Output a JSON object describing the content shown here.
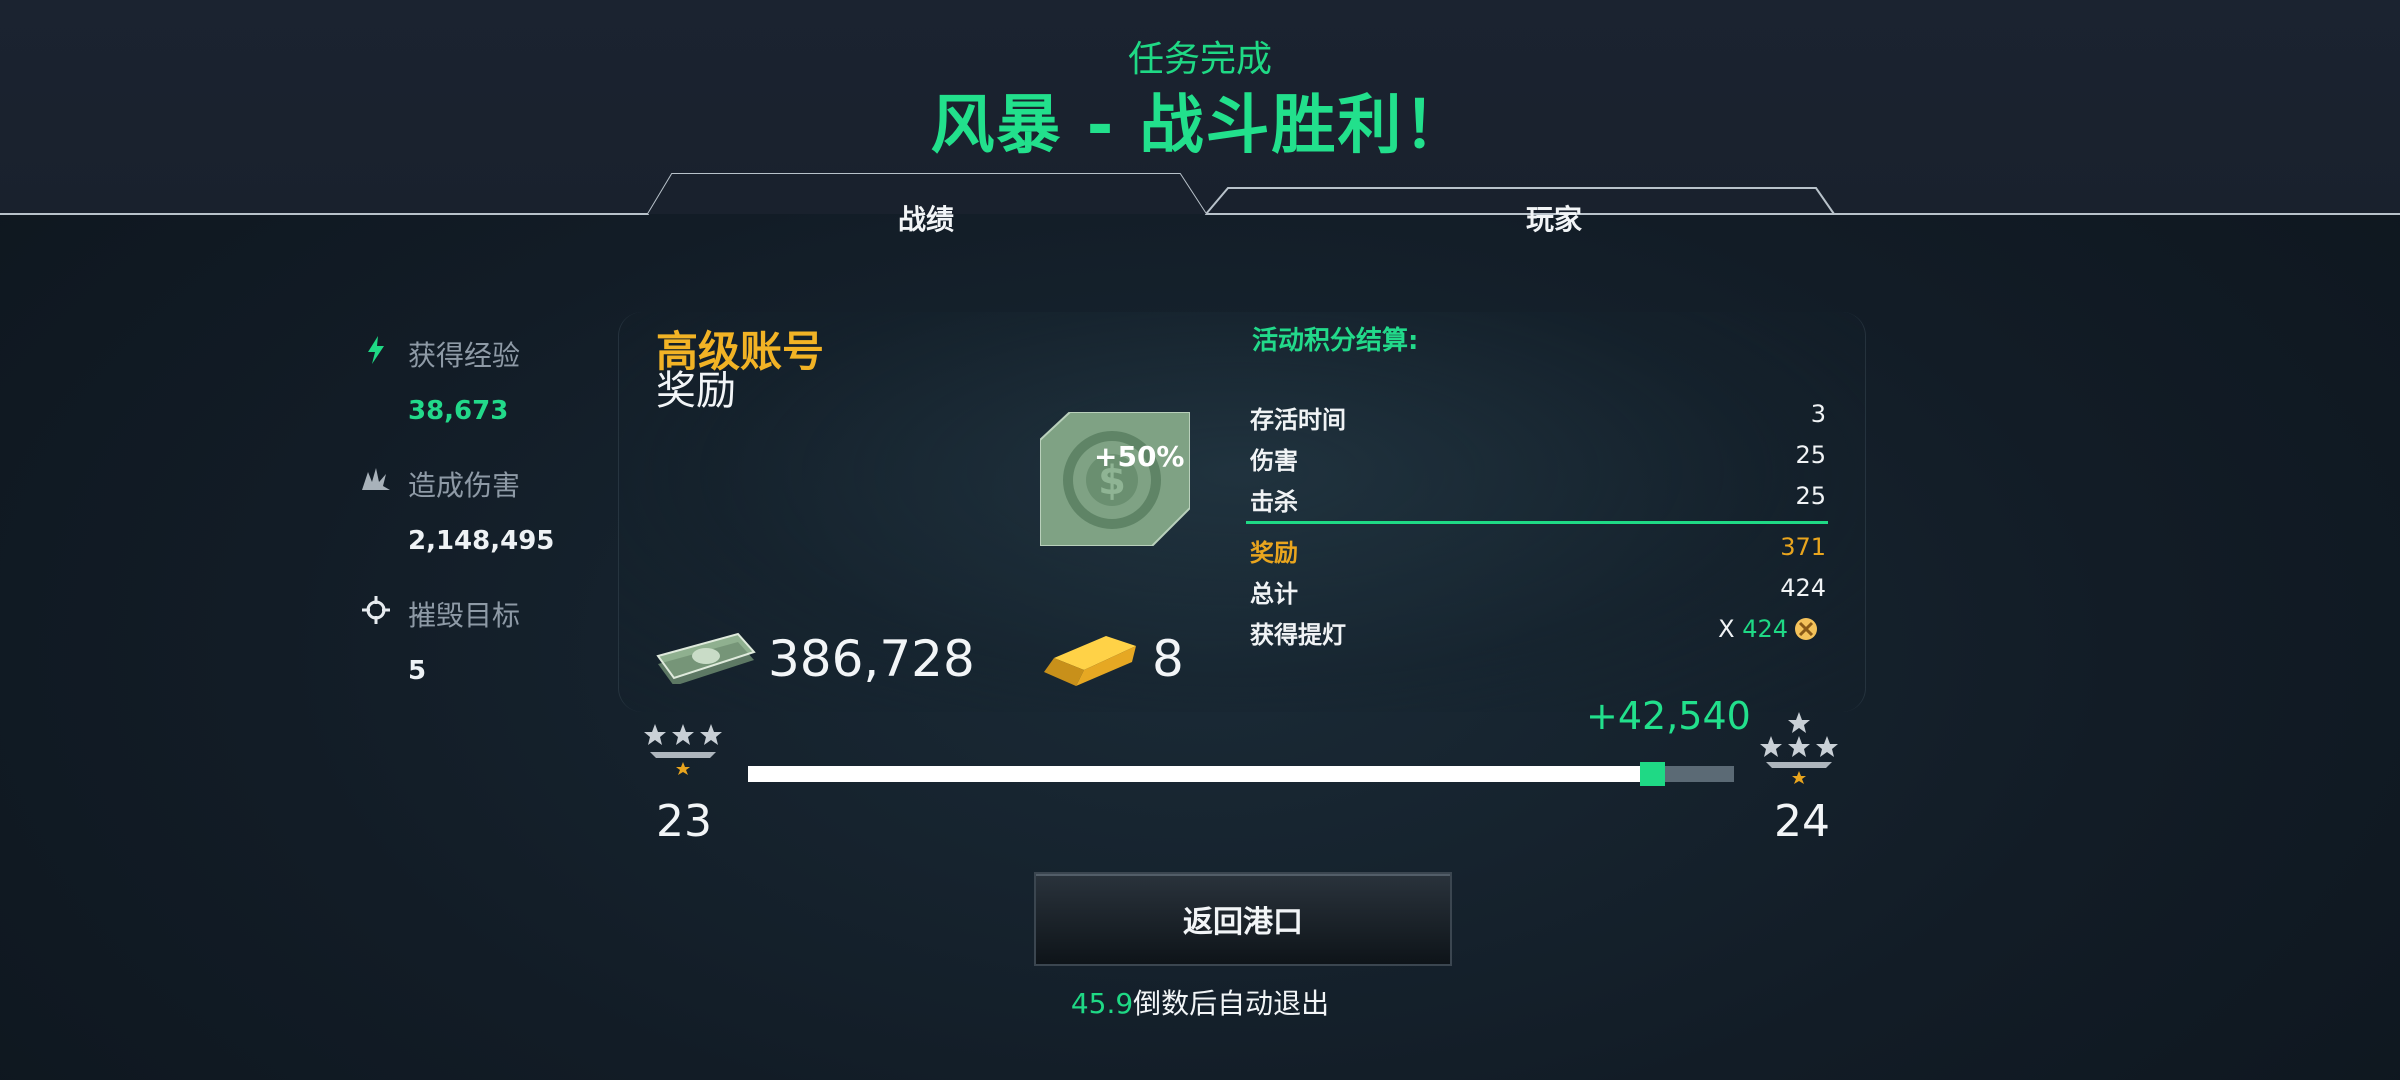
{
  "header": {
    "subtitle": "任务完成",
    "title": "风暴 - 战斗胜利！"
  },
  "tabs": [
    {
      "label": "战绩",
      "active": true
    },
    {
      "label": "玩家",
      "active": false
    }
  ],
  "stats": [
    {
      "icon": "lightning-icon",
      "label": "获得经验",
      "value": "38,673",
      "value_color": "#22d98a"
    },
    {
      "icon": "explosion-icon",
      "label": "造成伤害",
      "value": "2,148,495"
    },
    {
      "icon": "crosshair-icon",
      "label": "摧毁目标",
      "value": "5"
    }
  ],
  "premium": {
    "title": "高级账号",
    "subtitle": "奖励",
    "boost": "+50%"
  },
  "rewards": {
    "money": "386,728",
    "gold": "8"
  },
  "event_points": {
    "title": "活动积分结算:",
    "rows": [
      {
        "label": "存活时间",
        "value": "3"
      },
      {
        "label": "伤害",
        "value": "25"
      },
      {
        "label": "击杀",
        "value": "25"
      }
    ],
    "reward": {
      "label": "奖励",
      "value": "371"
    },
    "total": {
      "label": "总计",
      "value": "424"
    },
    "lamps": {
      "label": "获得提灯",
      "prefix": "X",
      "value": "424"
    }
  },
  "progress": {
    "gain": "+42,540",
    "current_level": "23",
    "next_level": "24",
    "previous_fraction": 0.905,
    "current_fraction": 0.93
  },
  "actions": {
    "return_label": "返回港口"
  },
  "countdown": {
    "seconds": "45.9",
    "text": "倒数后自动退出"
  },
  "colors": {
    "accent": "#22e08c",
    "gold": "#f2b325",
    "reward": "#e9a51e"
  }
}
